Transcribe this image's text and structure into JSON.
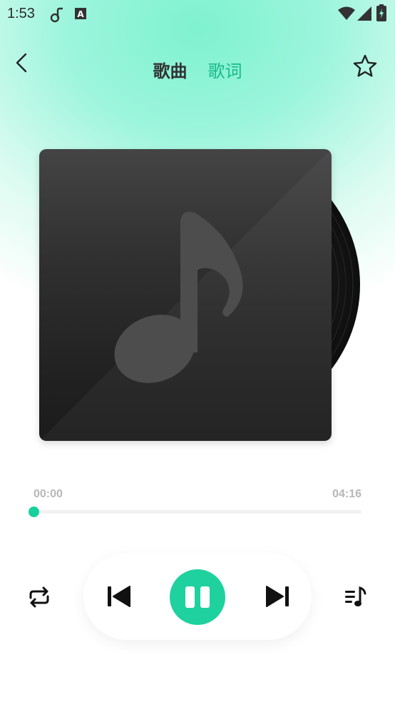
{
  "status_bar": {
    "time": "1:53",
    "icons": [
      "app-notification-icon",
      "a-icon",
      "wifi-icon",
      "signal-icon",
      "battery-icon"
    ]
  },
  "header": {
    "tabs": [
      {
        "label": "歌曲",
        "active": true
      },
      {
        "label": "歌词",
        "active": false
      }
    ],
    "back_icon": "chevron-left-icon",
    "favorite_icon": "star-outline-icon"
  },
  "player": {
    "album_art_icon": "music-note-icon",
    "current_time": "00:00",
    "total_time": "04:16",
    "progress": 0
  },
  "controls": {
    "repeat_icon": "repeat-icon",
    "prev_icon": "skip-previous-icon",
    "play_pause_icon": "pause-icon",
    "next_icon": "skip-next-icon",
    "playlist_icon": "playlist-icon"
  },
  "colors": {
    "accent": "#1fd19e",
    "tab_inactive": "#19b98a",
    "background_top": "#7ff2cf"
  }
}
